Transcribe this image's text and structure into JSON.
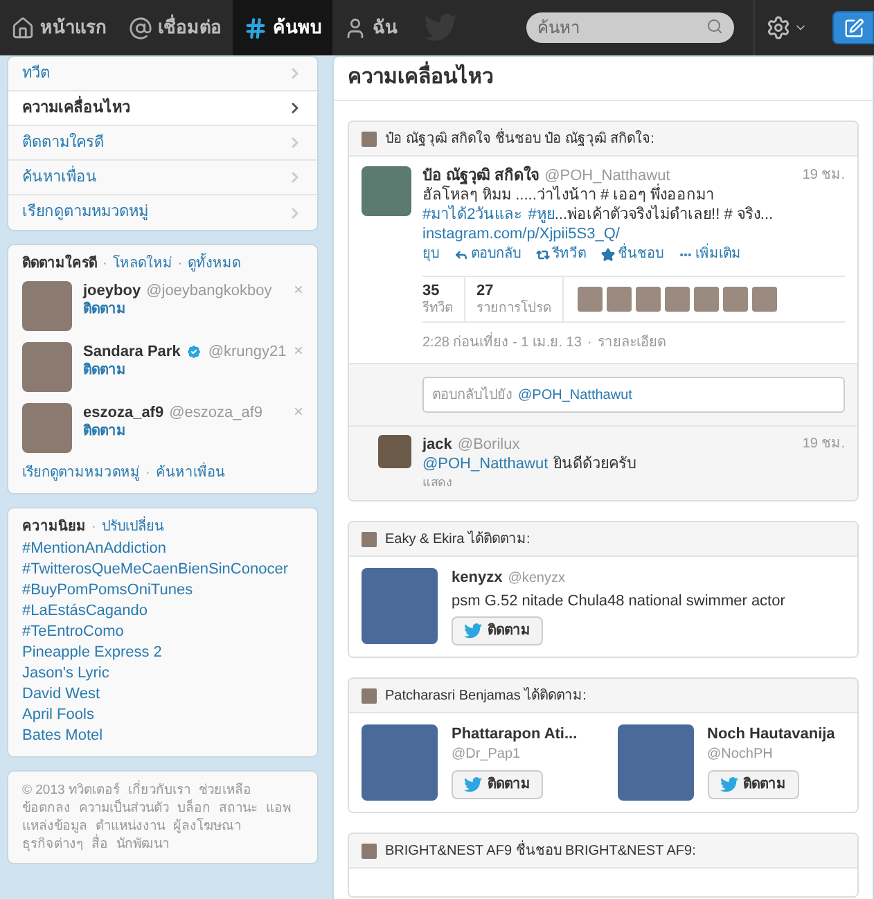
{
  "topbar": {
    "nav": [
      {
        "kind": "home",
        "label": "หน้าแรก",
        "selected": false
      },
      {
        "kind": "connect",
        "label": "เชื่อมต่อ",
        "selected": false
      },
      {
        "kind": "discover",
        "label": "ค้นพบ",
        "selected": true
      },
      {
        "kind": "me",
        "label": "ฉัน",
        "selected": false
      }
    ],
    "search": {
      "placeholder": "ค้นหา"
    }
  },
  "sidebar": {
    "menu": [
      {
        "label": "ทวีต",
        "selected": false
      },
      {
        "label": "ความเคลื่อนไหว",
        "selected": true
      },
      {
        "label": "ติดตามใครดี",
        "selected": false
      },
      {
        "label": "ค้นหาเพื่อน",
        "selected": false
      },
      {
        "label": "เรียกดูตามหมวดหมู่",
        "selected": false
      }
    ],
    "who_to_follow": {
      "title": "ติดตามใครดี",
      "separator": "·",
      "links": [
        "โหลดใหม่",
        "ดูทั้งหมด"
      ],
      "users": [
        {
          "name": "joeyboy",
          "handle": "@joeybangkokboy",
          "verified": false,
          "action": "ติดตาม",
          "dismiss": "×"
        },
        {
          "name": "Sandara Park",
          "handle": "@krungy21",
          "verified": true,
          "action": "ติดตาม",
          "dismiss": "×"
        },
        {
          "name": "eszoza_af9",
          "handle": "@eszoza_af9",
          "verified": false,
          "action": "ติดตาม",
          "dismiss": "×"
        }
      ],
      "footer_links": [
        "เรียกดูตามหมวดหมู่",
        "ค้นหาเพื่อน"
      ]
    },
    "trends": {
      "title": "ความนิยม",
      "separator": "·",
      "change": "ปรับเปลี่ยน",
      "items": [
        "#MentionAnAddiction",
        "#TwitterosQueMeCaenBienSinConocer",
        "#BuyPomPomsOniTunes",
        "#LaEstásCagando",
        "#TeEntroComo",
        "Pineapple Express 2",
        "Jason's Lyric",
        "David West",
        "April Fools",
        "Bates Motel"
      ]
    },
    "footer": [
      "© 2013 ทวิตเตอร์",
      "เกี่ยวกับเรา",
      "ช่วยเหลือ",
      "ข้อตกลง",
      "ความเป็นส่วนตัว",
      "บล็อก",
      "สถานะ",
      "แอพ",
      "แหล่งข้อมูล",
      "ตำแหน่งงาน",
      "ผู้ลงโฆษณา",
      "ธุรกิจต่างๆ",
      "สื่อ",
      "นักพัฒนา"
    ]
  },
  "main": {
    "title": "ความเคลื่อนไหว",
    "activities": [
      {
        "kind": "favorite",
        "header": "ป๋อ ณัฐวุฒิ สกิดใจ ชื่นชอบ ป๋อ ณัฐวุฒิ สกิดใจ:",
        "tweet": {
          "name": "ป๋อ ณัฐวุฒิ สกิดใจ",
          "handle": "@POH_Natthawut",
          "time": "19 ชม.",
          "text": [
            {
              "kind": "text",
              "value": "ฮัลโหลๆ หิมม .....ว่าไงน้าา # เออๆ พึ่งออกมา "
            },
            {
              "kind": "link",
              "value": "#มาได้2วันและ"
            },
            {
              "kind": "link",
              "value": "#หูย"
            },
            {
              "kind": "text",
              "value": "...พ่อเค้าตัวจริงไม่ดำเลย!! # จริง..."
            }
          ],
          "url": "instagram.com/p/Xjpii5S3_Q/",
          "actions": [
            {
              "kind": "collapse",
              "label": "ยุบ"
            },
            {
              "kind": "reply",
              "label": "ตอบกลับ"
            },
            {
              "kind": "retweet",
              "label": "รีทวีต"
            },
            {
              "kind": "favorite",
              "label": "ชื่นชอบ"
            },
            {
              "kind": "more",
              "label": "เพิ่มเติม"
            }
          ],
          "stats": [
            {
              "value": "35",
              "label": "รีทวีต"
            },
            {
              "value": "27",
              "label": "รายการโปรด"
            }
          ],
          "timestamp": "2:28 ก่อนเที่ยง - 1 เม.ย. 13",
          "separator": "·",
          "details": "รายละเอียด",
          "reply_box": {
            "prefix": "ตอบกลับไปยัง",
            "mention": "@POH_Natthawut"
          },
          "replies": [
            {
              "name": "jack",
              "handle": "@Borilux",
              "time": "19 ชม.",
              "mention": "@POH_Natthawut",
              "text": "ยินดีด้วยครับ",
              "show": "แสดง"
            }
          ]
        }
      },
      {
        "kind": "follow",
        "header": "Eaky & Ekira ได้ติดตาม:",
        "users": [
          {
            "name": "kenyzx",
            "handle": "@kenyzx",
            "bio": "psm G.52 nitade Chula48 national swimmer actor",
            "button": "ติดตาม"
          }
        ]
      },
      {
        "kind": "follow",
        "header": "Patcharasri Benjamas ได้ติดตาม:",
        "users": [
          {
            "name": "Phattarapon Ati...",
            "handle": "@Dr_Pap1",
            "button": "ติดตาม"
          },
          {
            "name": "Noch Hautavanija",
            "handle": "@NochPH",
            "button": "ติดตาม"
          }
        ]
      },
      {
        "kind": "header_only",
        "header": "BRIGHT&NEST AF9 ชื่นชอบ BRIGHT&NEST AF9:"
      }
    ]
  }
}
